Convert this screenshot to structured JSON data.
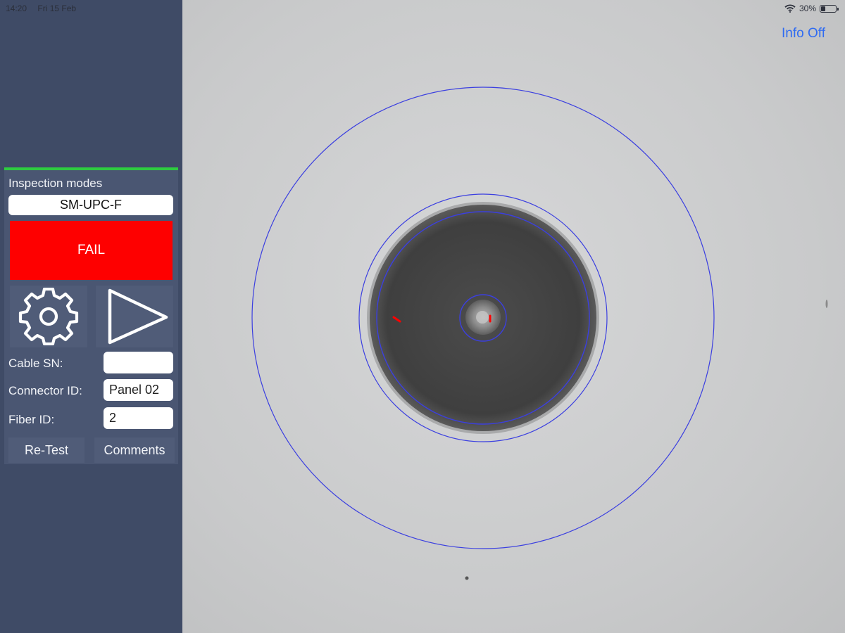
{
  "status": {
    "time": "14:20",
    "date": "Fri 15 Feb",
    "battery_text": "30%",
    "battery_level": 0.3
  },
  "sidebar": {
    "section_title": "Inspection modes",
    "mode": "SM-UPC-F",
    "result": "FAIL",
    "settings_icon": "gear-icon",
    "start_icon": "play-icon",
    "fields": {
      "cable_sn": {
        "label": "Cable SN:",
        "value": ""
      },
      "connector_id": {
        "label": "Connector ID:",
        "value": "Panel 02"
      },
      "fiber_id": {
        "label": "Fiber ID:",
        "value": "2"
      }
    },
    "retest_label": "Re-Test",
    "comments_label": "Comments"
  },
  "viewer": {
    "info_toggle": "Info Off",
    "zone_color": "#3b3fe0",
    "defect_color": "#ff0000"
  },
  "colors": {
    "sidebar_bg": "#3f4b66",
    "panel_bg": "#4a5672",
    "accent_green": "#2ecc40",
    "fail_red": "#fe0000",
    "link_blue": "#2f6bf2"
  }
}
